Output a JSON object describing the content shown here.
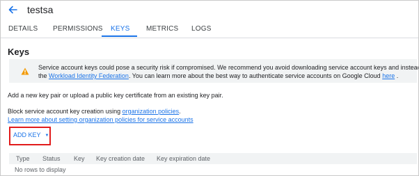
{
  "header": {
    "title": "testsa",
    "back_icon": "arrow-back-icon"
  },
  "tabs": [
    {
      "label": "DETAILS",
      "active": false
    },
    {
      "label": "PERMISSIONS",
      "active": false
    },
    {
      "label": "KEYS",
      "active": true
    },
    {
      "label": "METRICS",
      "active": false
    },
    {
      "label": "LOGS",
      "active": false
    }
  ],
  "section": {
    "title": "Keys"
  },
  "warning": {
    "icon": "warning-triangle-icon",
    "icon_color": "#f29900",
    "line1": "Service account keys could pose a security risk if compromised. We recommend you avoid downloading service account keys and instead use",
    "line2_prefix": "the",
    "link1": "Workload Identity Federation",
    "line2_middle": ". You can learn more about the best way to authenticate service accounts on Google Cloud",
    "link2": "here",
    "line2_suffix": "."
  },
  "body": {
    "add_text": "Add a new key pair or upload a public key certificate from an existing key pair.",
    "block_text_prefix": "Block service account key creation using",
    "block_link": "organization policies",
    "block_text_suffix": ".",
    "learn_more": "Learn more about setting organization policies for service accounts"
  },
  "add_key": {
    "label": "ADD KEY",
    "highlight_color": "#e11b1b"
  },
  "table": {
    "columns": [
      "Type",
      "Status",
      "Key",
      "Key creation date",
      "Key expiration date"
    ],
    "empty_message": "No rows to display"
  },
  "colors": {
    "accent": "#1a73e8"
  }
}
